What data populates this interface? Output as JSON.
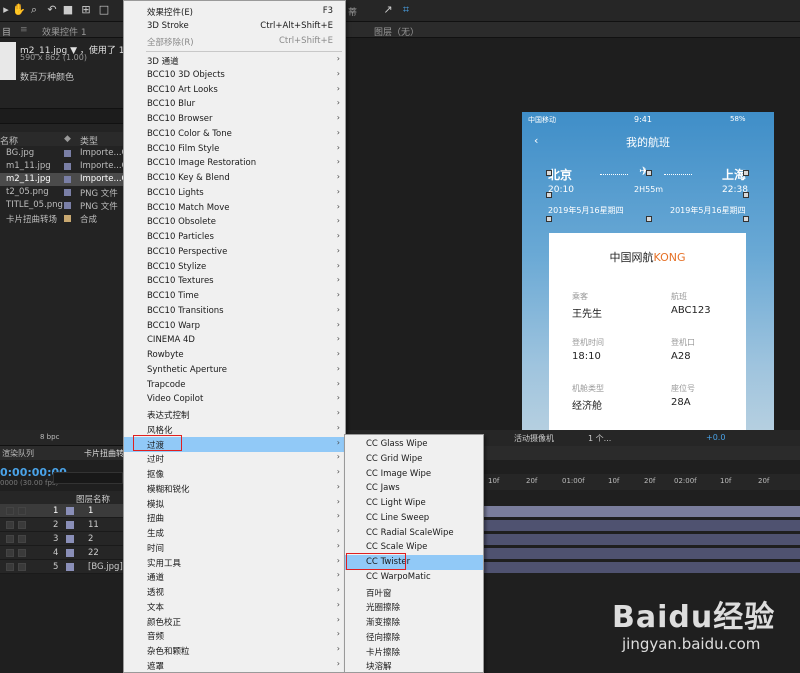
{
  "toolbar": {
    "tab_right": "蒂",
    "layer_label": "图层（无）"
  },
  "project": {
    "tab_effects": "效果控件 1",
    "file_name": "m2_11.jpg ▼ ，使用了 1 次",
    "dimensions": "590 x 862 (1.00)",
    "color_mode": "数百万种颜色",
    "col_name": "名称",
    "col_type": "类型",
    "rows": [
      {
        "name": "BG.jpg",
        "type": "Importe...G"
      },
      {
        "name": "m1_11.jpg",
        "type": "Importe...G"
      },
      {
        "name": "m2_11.jpg",
        "type": "Importe...G"
      },
      {
        "name": "t2_05.png",
        "type": "PNG 文件"
      },
      {
        "name": "TITLE_05.png",
        "type": "PNG 文件"
      },
      {
        "name": "卡片扭曲转场",
        "type": "合成"
      }
    ]
  },
  "phone": {
    "carrier": "中国移动 ",
    "time": "9:41",
    "battery": "58%",
    "title": "我的航班",
    "from_city": "北京",
    "to_city": "上海",
    "dep_time": "20:10",
    "duration": "2H55m",
    "arr_time": "22:38",
    "dep_date": "2019年5月16星期四",
    "arr_date": "2019年5月16星期四",
    "card": {
      "title_main": "中国网航",
      "title_brand": "KONG",
      "passenger_label": "乘客",
      "passenger": "王先生",
      "flight_label": "航班",
      "flight": "ABC123",
      "board_time_label": "登机时间",
      "board_time": "18:10",
      "gate_label": "登机口",
      "gate": "A28",
      "cabin_label": "机舱类型",
      "cabin": "经济舱",
      "seat_label": "座位号",
      "seat": "28A"
    }
  },
  "timeline": {
    "bpc": "8 bpc",
    "render_queue": "渲染队列",
    "comp_tab": "卡片扭曲转",
    "timecode": "0:00:00:00",
    "timecode_sub": "0000 (30.00 fps)",
    "layer_name_header": "图层名称",
    "camera": "活动摄像机",
    "view_count": "1 个...",
    "exposure": "+0.0",
    "ruler": [
      "10f",
      "20f",
      "01:00f",
      "10f",
      "20f",
      "02:00f",
      "10f",
      "20f"
    ],
    "layers": [
      {
        "num": "1",
        "name": "1"
      },
      {
        "num": "2",
        "name": "11"
      },
      {
        "num": "3",
        "name": "2"
      },
      {
        "num": "4",
        "name": "22"
      },
      {
        "num": "5",
        "name": "[BG.jpg]"
      }
    ]
  },
  "effect_menu": {
    "items": [
      {
        "label": "效果控件(E)",
        "shortcut": "F3"
      },
      {
        "label": "3D Stroke",
        "shortcut": "Ctrl+Alt+Shift+E"
      },
      {
        "label": "全部移除(R)",
        "shortcut": "Ctrl+Shift+E"
      },
      {
        "label": "3D 通道"
      },
      {
        "label": "BCC10 3D Objects"
      },
      {
        "label": "BCC10 Art Looks"
      },
      {
        "label": "BCC10 Blur"
      },
      {
        "label": "BCC10 Browser"
      },
      {
        "label": "BCC10 Color & Tone"
      },
      {
        "label": "BCC10 Film Style"
      },
      {
        "label": "BCC10 Image Restoration"
      },
      {
        "label": "BCC10 Key & Blend"
      },
      {
        "label": "BCC10 Lights"
      },
      {
        "label": "BCC10 Match Move"
      },
      {
        "label": "BCC10 Obsolete"
      },
      {
        "label": "BCC10 Particles"
      },
      {
        "label": "BCC10 Perspective"
      },
      {
        "label": "BCC10 Stylize"
      },
      {
        "label": "BCC10 Textures"
      },
      {
        "label": "BCC10 Time"
      },
      {
        "label": "BCC10 Transitions"
      },
      {
        "label": "BCC10 Warp"
      },
      {
        "label": "CINEMA 4D"
      },
      {
        "label": "Rowbyte"
      },
      {
        "label": "Synthetic Aperture"
      },
      {
        "label": "Trapcode"
      },
      {
        "label": "Video Copilot"
      },
      {
        "label": "表达式控制"
      },
      {
        "label": "风格化"
      },
      {
        "label": "过渡"
      },
      {
        "label": "过时"
      },
      {
        "label": "抠像"
      },
      {
        "label": "模糊和锐化"
      },
      {
        "label": "模拟"
      },
      {
        "label": "扭曲"
      },
      {
        "label": "生成"
      },
      {
        "label": "时间"
      },
      {
        "label": "实用工具"
      },
      {
        "label": "通道"
      },
      {
        "label": "透视"
      },
      {
        "label": "文本"
      },
      {
        "label": "颜色校正"
      },
      {
        "label": "音频"
      },
      {
        "label": "杂色和颗粒"
      },
      {
        "label": "遮罩"
      }
    ]
  },
  "transition_submenu": {
    "items": [
      "CC Glass Wipe",
      "CC Grid Wipe",
      "CC Image Wipe",
      "CC Jaws",
      "CC Light Wipe",
      "CC Line Sweep",
      "CC Radial ScaleWipe",
      "CC Scale Wipe",
      "CC Twister",
      "CC WarpoMatic",
      "百叶窗",
      "光圈擦除",
      "渐变擦除",
      "径向擦除",
      "卡片擦除",
      "块溶解"
    ]
  },
  "watermark": {
    "brand": "Baidu经验",
    "url": "jingyan.baidu.com"
  },
  "colors": {
    "menu_highlight": "#91c9f7",
    "red_outline": "#e02020",
    "timecode_blue": "#4aa3e8",
    "brand_orange": "#e67127"
  }
}
